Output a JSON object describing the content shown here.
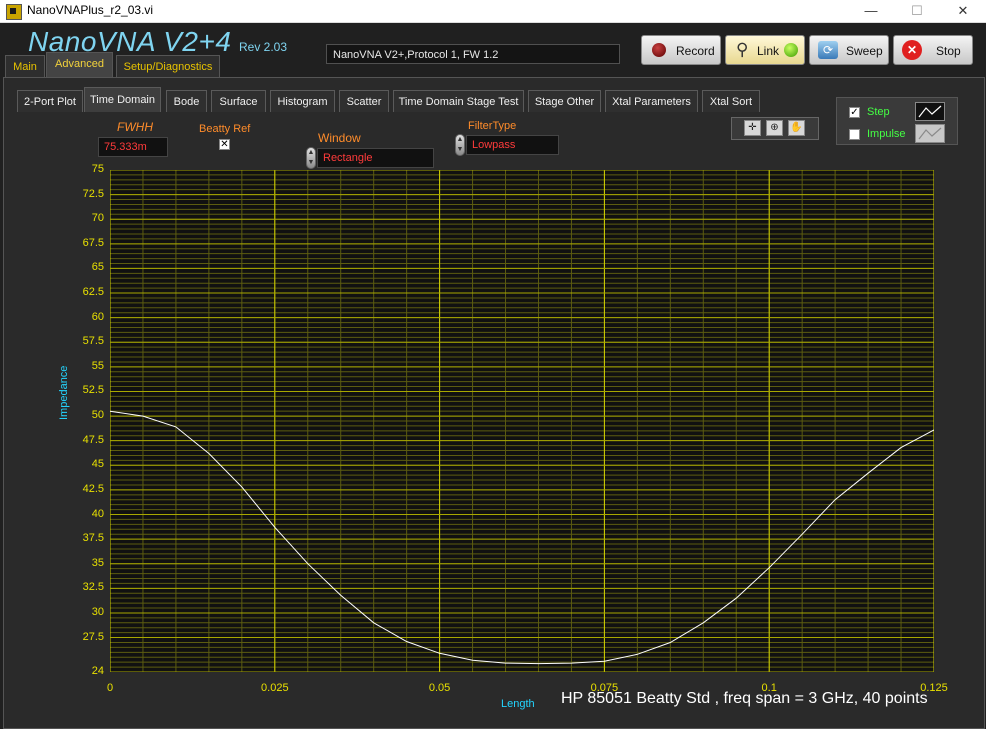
{
  "window": {
    "title": "NanoVNAPlus_r2_03.vi",
    "minimize": "—",
    "maximize": "☐",
    "close": "✕"
  },
  "header": {
    "brand": "NanoVNA V2+4",
    "rev": "Rev 2.03",
    "status": "NanoVNA V2+,Protocol 1, FW 1.2",
    "buttons": {
      "record": "Record",
      "link": "Link",
      "sweep": "Sweep",
      "stop": "Stop"
    }
  },
  "tabs": {
    "main": "Main",
    "advanced": "Advanced",
    "setup": "Setup/Diagnostics"
  },
  "subtabs": [
    "2-Port Plot",
    "Time Domain",
    "Bode",
    "Surface",
    "Histogram",
    "Scatter",
    "Time Domain Stage Test",
    "Stage Other",
    "Xtal Parameters",
    "Xtal Sort"
  ],
  "controls": {
    "fwhh_label": "FWHH",
    "fwhh_value": "75.333m",
    "beatty_label": "Beatty Ref",
    "beatty_checked": "✕",
    "window_label": "Window",
    "window_value": "Rectangle",
    "filter_label": "FilterType",
    "filter_value": "Lowpass"
  },
  "legend": {
    "step": "Step",
    "impulse": "Impulse",
    "step_checked": "✓"
  },
  "chart_data": {
    "type": "line",
    "xlabel": "Length",
    "ylabel": "Impedance",
    "xlim": [
      0,
      0.125
    ],
    "ylim": [
      24,
      75
    ],
    "x_ticks": [
      "0",
      "0.025",
      "0.05",
      "0.075",
      "0.1",
      "0.125"
    ],
    "y_ticks": [
      "75",
      "72.5",
      "70",
      "67.5",
      "65",
      "62.5",
      "60",
      "57.5",
      "55",
      "52.5",
      "50",
      "47.5",
      "45",
      "42.5",
      "40",
      "37.5",
      "35",
      "32.5",
      "30",
      "27.5",
      "24"
    ],
    "grid": true,
    "colors": {
      "trace": "#ffffff",
      "grid": "#d4d400",
      "axis_labels": "#23d5ff"
    },
    "series": [
      {
        "x": [
          0,
          0.005,
          0.01,
          0.015,
          0.02,
          0.025,
          0.03,
          0.035,
          0.04,
          0.045,
          0.05,
          0.055,
          0.06,
          0.065,
          0.07,
          0.075,
          0.08,
          0.085,
          0.09,
          0.095,
          0.1,
          0.105,
          0.11,
          0.115,
          0.12,
          0.125
        ],
        "y": [
          50.5,
          50.0,
          48.9,
          46.2,
          42.8,
          38.7,
          35.0,
          31.8,
          29.0,
          27.1,
          25.9,
          25.2,
          24.9,
          24.85,
          24.9,
          25.1,
          25.8,
          27.0,
          29.0,
          31.5,
          34.6,
          38.0,
          41.5,
          44.2,
          46.8,
          48.6
        ]
      }
    ]
  },
  "caption": "HP 85051 Beatty Std , freq span = 3 GHz, 40 points"
}
